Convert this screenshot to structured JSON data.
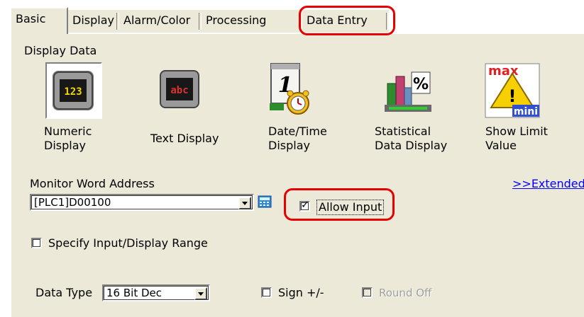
{
  "tabs": [
    {
      "label": "Basic",
      "active": true
    },
    {
      "label": "Display",
      "active": false
    },
    {
      "label": "Alarm/Color",
      "active": false
    },
    {
      "label": "Processing",
      "active": false
    },
    {
      "label": "Data Entry",
      "active": false
    }
  ],
  "display_data": {
    "heading": "Display Data",
    "items": [
      {
        "label": "Numeric Display",
        "line1": "Numeric",
        "line2": "Display",
        "icon": "numeric-display-icon",
        "selected": true
      },
      {
        "label": "Text Display",
        "line1": "Text Display",
        "line2": "",
        "icon": "text-display-icon",
        "selected": false
      },
      {
        "label": "Date/Time Display",
        "line1": "Date/Time",
        "line2": "Display",
        "icon": "date-time-display-icon",
        "selected": false
      },
      {
        "label": "Statistical Data Display",
        "line1": "Statistical",
        "line2": "Data Display",
        "icon": "statistical-data-icon",
        "selected": false
      },
      {
        "label": "Show Limit Value",
        "line1": "Show Limit",
        "line2": "Value",
        "icon": "show-limit-value-icon",
        "selected": false
      }
    ],
    "icon_text": {
      "numeric": "123",
      "text": "abc",
      "date": "1",
      "stat": "%",
      "max": "max",
      "mini": "mini",
      "warn": "!"
    }
  },
  "monitor": {
    "label": "Monitor Word Address",
    "address_value": "[PLC1]D00100",
    "extended_link": ">>Extended"
  },
  "allow_input": {
    "label": "Allow Input",
    "checked": true
  },
  "specify_range": {
    "label": "Specify Input/Display Range",
    "checked": false
  },
  "data_type": {
    "label": "Data Type",
    "value": "16 Bit Dec",
    "sign_label": "Sign +/-",
    "sign_checked": false,
    "round_off_label": "Round Off",
    "round_off_checked": false,
    "round_off_enabled": false
  },
  "colors": {
    "highlight": "#e60000",
    "link": "#0000ff",
    "panel": "#ece9d8"
  }
}
